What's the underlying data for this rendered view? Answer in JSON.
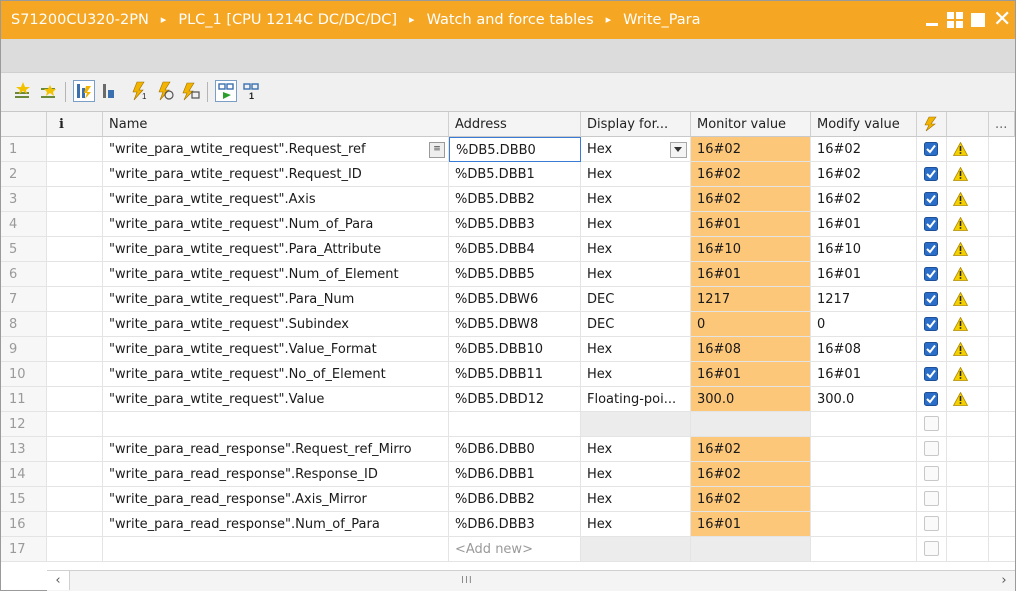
{
  "titlebar": {
    "crumbs": [
      "S71200CU320-2PN",
      "PLC_1 [CPU 1214C DC/DC/DC]",
      "Watch and force tables",
      "Write_Para"
    ],
    "separator": "▸",
    "minimize_icon": "minimize-icon",
    "tile_icon": "tile-window-icon",
    "maximize_icon": "maximize-icon",
    "close_label": "✕"
  },
  "colors": {
    "accent": "#f5a623",
    "monitor_fill": "#fdc77a",
    "check_blue": "#2a6ec9",
    "warn_yellow": "#f5d000"
  },
  "toolbar": {
    "icons": [
      "insert-row-icon",
      "add-row-icon",
      "display-all-modify-values-icon",
      "show-hide-columns-icon",
      "modify-now-icon",
      "modify-with-trigger-icon",
      "enable-peripheral-outputs-icon",
      "monitor-all-icon",
      "monitor-now-icon"
    ]
  },
  "table": {
    "headers": {
      "info": "i",
      "name": "Name",
      "address": "Address",
      "display": "Display for...",
      "monitor": "Monitor value",
      "modify": "Modify value",
      "more": "..."
    },
    "rows": [
      {
        "num": "1",
        "name": "\"write_para_wtite_request\".Request_ref",
        "address": "%DB5.DBB0",
        "display": "Hex",
        "monitor": "16#02",
        "modify": "16#02",
        "checked": true,
        "warn": true
      },
      {
        "num": "2",
        "name": "\"write_para_wtite_request\".Request_ID",
        "address": "%DB5.DBB1",
        "display": "Hex",
        "monitor": "16#02",
        "modify": "16#02",
        "checked": true,
        "warn": true
      },
      {
        "num": "3",
        "name": "\"write_para_wtite_request\".Axis",
        "address": "%DB5.DBB2",
        "display": "Hex",
        "monitor": "16#02",
        "modify": "16#02",
        "checked": true,
        "warn": true
      },
      {
        "num": "4",
        "name": "\"write_para_wtite_request\".Num_of_Para",
        "address": "%DB5.DBB3",
        "display": "Hex",
        "monitor": "16#01",
        "modify": "16#01",
        "checked": true,
        "warn": true
      },
      {
        "num": "5",
        "name": "\"write_para_wtite_request\".Para_Attribute",
        "address": "%DB5.DBB4",
        "display": "Hex",
        "monitor": "16#10",
        "modify": "16#10",
        "checked": true,
        "warn": true
      },
      {
        "num": "6",
        "name": "\"write_para_wtite_request\".Num_of_Element",
        "address": "%DB5.DBB5",
        "display": "Hex",
        "monitor": "16#01",
        "modify": "16#01",
        "checked": true,
        "warn": true
      },
      {
        "num": "7",
        "name": "\"write_para_wtite_request\".Para_Num",
        "address": "%DB5.DBW6",
        "display": "DEC",
        "monitor": "1217",
        "modify": "1217",
        "checked": true,
        "warn": true
      },
      {
        "num": "8",
        "name": "\"write_para_wtite_request\".Subindex",
        "address": "%DB5.DBW8",
        "display": "DEC",
        "monitor": "0",
        "modify": "0",
        "checked": true,
        "warn": true
      },
      {
        "num": "9",
        "name": "\"write_para_wtite_request\".Value_Format",
        "address": "%DB5.DBB10",
        "display": "Hex",
        "monitor": "16#08",
        "modify": "16#08",
        "checked": true,
        "warn": true
      },
      {
        "num": "10",
        "name": "\"write_para_wtite_request\".No_of_Element",
        "address": "%DB5.DBB11",
        "display": "Hex",
        "monitor": "16#01",
        "modify": "16#01",
        "checked": true,
        "warn": true
      },
      {
        "num": "11",
        "name": "\"write_para_wtite_request\".Value",
        "address": "%DB5.DBD12",
        "display": "Floating-poi...",
        "monitor": "300.0",
        "modify": "300.0",
        "checked": true,
        "warn": true
      },
      {
        "num": "12",
        "name": "",
        "address": "",
        "display": "",
        "monitor": "",
        "modify": "",
        "checked": false,
        "warn": false,
        "empty": true
      },
      {
        "num": "13",
        "name": "\"write_para_read_response\".Request_ref_Mirro",
        "address": "%DB6.DBB0",
        "display": "Hex",
        "monitor": "16#02",
        "modify": "",
        "checked": false,
        "warn": false
      },
      {
        "num": "14",
        "name": "\"write_para_read_response\".Response_ID",
        "address": "%DB6.DBB1",
        "display": "Hex",
        "monitor": "16#02",
        "modify": "",
        "checked": false,
        "warn": false
      },
      {
        "num": "15",
        "name": "\"write_para_read_response\".Axis_Mirror",
        "address": "%DB6.DBB2",
        "display": "Hex",
        "monitor": "16#02",
        "modify": "",
        "checked": false,
        "warn": false
      },
      {
        "num": "16",
        "name": "\"write_para_read_response\".Num_of_Para",
        "address": "%DB6.DBB3",
        "display": "Hex",
        "monitor": "16#01",
        "modify": "",
        "checked": false,
        "warn": false
      },
      {
        "num": "17",
        "name": "",
        "address": "<Add new>",
        "display": "",
        "monitor": "",
        "modify": "",
        "checked": false,
        "warn": false,
        "addnew": true
      }
    ]
  },
  "scrollbar": {
    "left_arrow": "‹",
    "right_arrow": "›",
    "grip": "III"
  }
}
